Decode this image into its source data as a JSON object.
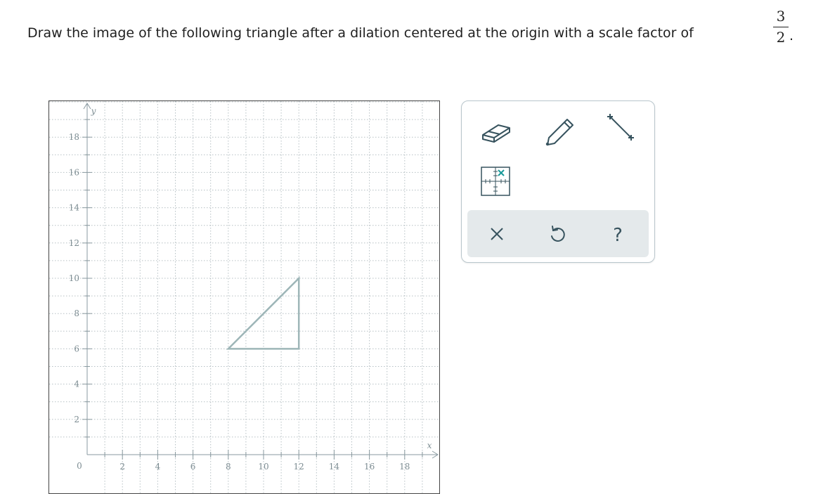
{
  "question": {
    "text": "Draw the image of the following triangle after a dilation centered at the origin with a scale factor of",
    "scale_numerator": "3",
    "scale_denominator": "2",
    "trailing_period": "."
  },
  "graph": {
    "x_axis_label": "x",
    "y_axis_label": "y",
    "origin_label": "0",
    "x_range": [
      0,
      20
    ],
    "y_range": [
      0,
      20
    ],
    "x_tick_labels": [
      2,
      4,
      6,
      8,
      10,
      12,
      14,
      16,
      18
    ],
    "y_tick_labels": [
      2,
      4,
      6,
      8,
      10,
      12,
      14,
      16,
      18
    ],
    "grid_step": 1,
    "grid": true,
    "triangle_vertices": [
      [
        8,
        6
      ],
      [
        12,
        6
      ],
      [
        12,
        10
      ]
    ],
    "triangle_color": "#9eb6b8"
  },
  "toolbox": {
    "tools": [
      "eraser-icon",
      "pencil-icon",
      "line-segment-icon",
      "point-grid-icon"
    ],
    "actions": [
      "clear-icon",
      "undo-icon",
      "help-icon"
    ],
    "help_label": "?",
    "accent_color": "#37535e",
    "point_tool_marker_color": "#1a9a9a",
    "action_bar_color": "#e4e9eb"
  }
}
